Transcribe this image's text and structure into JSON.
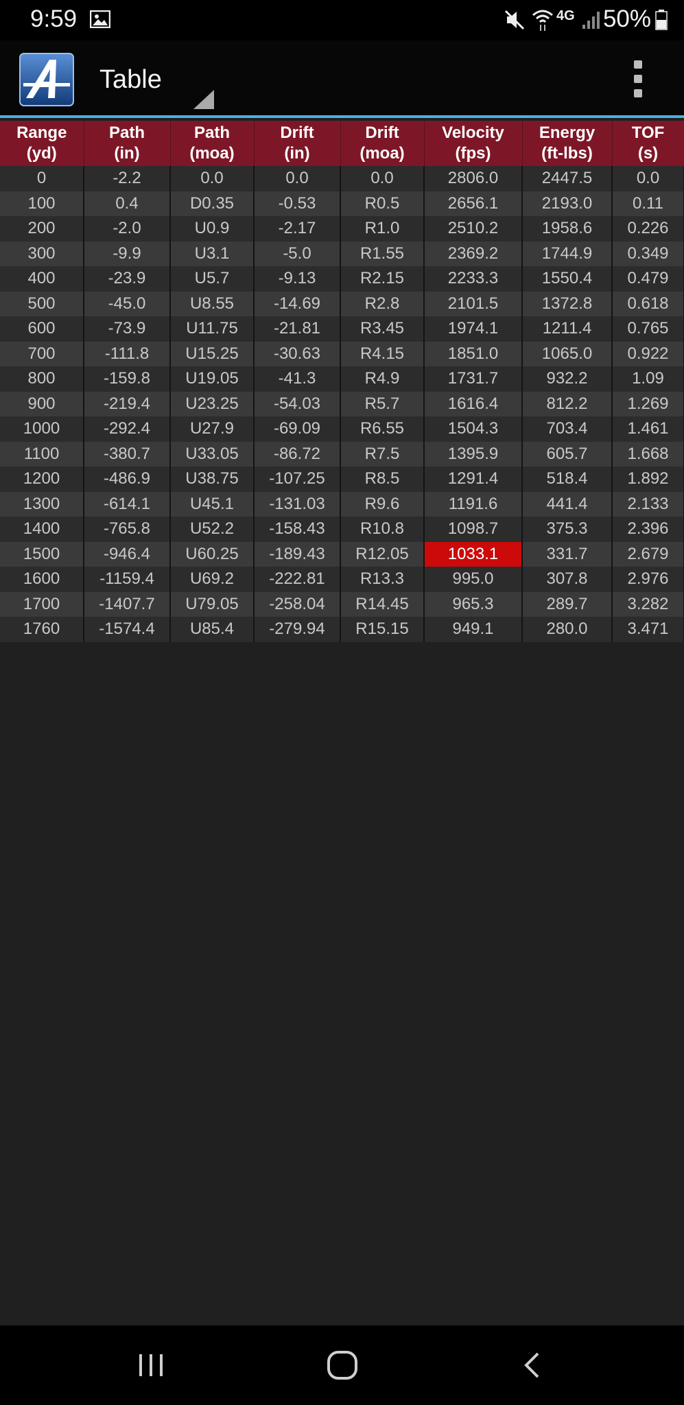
{
  "status_bar": {
    "time": "9:59",
    "network": "4G",
    "battery_percent": "50%"
  },
  "app_bar": {
    "title": "Table",
    "accent_color": "#48b0e4"
  },
  "table": {
    "header_color": "#7d1727",
    "highlight_color": "#cc0a0a",
    "columns": [
      {
        "top": "Range",
        "bottom": "(yd)"
      },
      {
        "top": "Path",
        "bottom": "(in)"
      },
      {
        "top": "Path",
        "bottom": "(moa)"
      },
      {
        "top": "Drift",
        "bottom": "(in)"
      },
      {
        "top": "Drift",
        "bottom": "(moa)"
      },
      {
        "top": "Velocity",
        "bottom": "(fps)"
      },
      {
        "top": "Energy",
        "bottom": "(ft-lbs)"
      },
      {
        "top": "TOF",
        "bottom": "(s)"
      }
    ],
    "rows": [
      [
        "0",
        "-2.2",
        "0.0",
        "0.0",
        "0.0",
        "2806.0",
        "2447.5",
        "0.0"
      ],
      [
        "100",
        "0.4",
        "D0.35",
        "-0.53",
        "R0.5",
        "2656.1",
        "2193.0",
        "0.11"
      ],
      [
        "200",
        "-2.0",
        "U0.9",
        "-2.17",
        "R1.0",
        "2510.2",
        "1958.6",
        "0.226"
      ],
      [
        "300",
        "-9.9",
        "U3.1",
        "-5.0",
        "R1.55",
        "2369.2",
        "1744.9",
        "0.349"
      ],
      [
        "400",
        "-23.9",
        "U5.7",
        "-9.13",
        "R2.15",
        "2233.3",
        "1550.4",
        "0.479"
      ],
      [
        "500",
        "-45.0",
        "U8.55",
        "-14.69",
        "R2.8",
        "2101.5",
        "1372.8",
        "0.618"
      ],
      [
        "600",
        "-73.9",
        "U11.75",
        "-21.81",
        "R3.45",
        "1974.1",
        "1211.4",
        "0.765"
      ],
      [
        "700",
        "-111.8",
        "U15.25",
        "-30.63",
        "R4.15",
        "1851.0",
        "1065.0",
        "0.922"
      ],
      [
        "800",
        "-159.8",
        "U19.05",
        "-41.3",
        "R4.9",
        "1731.7",
        "932.2",
        "1.09"
      ],
      [
        "900",
        "-219.4",
        "U23.25",
        "-54.03",
        "R5.7",
        "1616.4",
        "812.2",
        "1.269"
      ],
      [
        "1000",
        "-292.4",
        "U27.9",
        "-69.09",
        "R6.55",
        "1504.3",
        "703.4",
        "1.461"
      ],
      [
        "1100",
        "-380.7",
        "U33.05",
        "-86.72",
        "R7.5",
        "1395.9",
        "605.7",
        "1.668"
      ],
      [
        "1200",
        "-486.9",
        "U38.75",
        "-107.25",
        "R8.5",
        "1291.4",
        "518.4",
        "1.892"
      ],
      [
        "1300",
        "-614.1",
        "U45.1",
        "-131.03",
        "R9.6",
        "1191.6",
        "441.4",
        "2.133"
      ],
      [
        "1400",
        "-765.8",
        "U52.2",
        "-158.43",
        "R10.8",
        "1098.7",
        "375.3",
        "2.396"
      ],
      [
        "1500",
        "-946.4",
        "U60.25",
        "-189.43",
        "R12.05",
        "1033.1",
        "331.7",
        "2.679"
      ],
      [
        "1600",
        "-1159.4",
        "U69.2",
        "-222.81",
        "R13.3",
        "995.0",
        "307.8",
        "2.976"
      ],
      [
        "1700",
        "-1407.7",
        "U79.05",
        "-258.04",
        "R14.45",
        "965.3",
        "289.7",
        "3.282"
      ],
      [
        "1760",
        "-1574.4",
        "U85.4",
        "-279.94",
        "R15.15",
        "949.1",
        "280.0",
        "3.471"
      ]
    ],
    "highlighted_cell": {
      "row": 15,
      "col": 5
    }
  },
  "nav_bar": {
    "icons": [
      "recent-apps-icon",
      "home-icon",
      "back-icon"
    ]
  }
}
